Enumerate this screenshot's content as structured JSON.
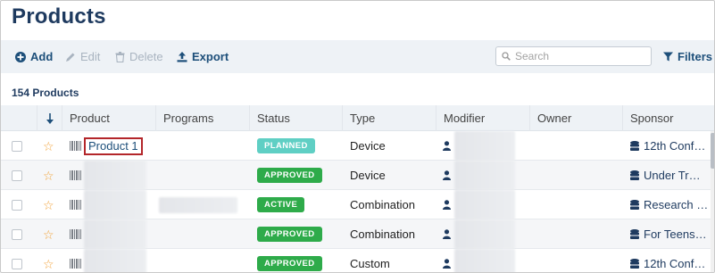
{
  "page": {
    "title": "Products"
  },
  "toolbar": {
    "add_label": "Add",
    "edit_label": "Edit",
    "delete_label": "Delete",
    "export_label": "Export",
    "filters_label": "Filters"
  },
  "search": {
    "placeholder": "Search",
    "value": ""
  },
  "summary": {
    "count_label": "154 Products"
  },
  "table": {
    "columns": [
      "Product",
      "Programs",
      "Status",
      "Type",
      "Modifier",
      "Owner",
      "Sponsor"
    ],
    "rows": [
      {
        "product": "Product 1",
        "status": "PLANNED",
        "status_kind": "planned",
        "type": "Device",
        "sponsor": "12th Conf…"
      },
      {
        "product": "",
        "status": "APPROVED",
        "status_kind": "approved",
        "type": "Device",
        "sponsor": "Under Tr…"
      },
      {
        "product": "",
        "status": "ACTIVE",
        "status_kind": "active",
        "type": "Combination",
        "sponsor": "Research …"
      },
      {
        "product": "",
        "status": "APPROVED",
        "status_kind": "approved",
        "type": "Combination",
        "sponsor": "For Teens…"
      },
      {
        "product": "",
        "status": "APPROVED",
        "status_kind": "approved",
        "type": "Custom",
        "sponsor": "12th Conf…"
      }
    ]
  },
  "colors": {
    "title": "#1e3a5f",
    "toolbar_bg": "#eef2f6",
    "planned": "#5fcfc4",
    "approved": "#2eab4a",
    "highlight_border": "#b3262a",
    "star": "#f2a33a"
  },
  "icons": [
    "plus-circle-icon",
    "pencil-icon",
    "trash-icon",
    "upload-icon",
    "search-icon",
    "filter-icon",
    "sort-down-arrow-icon",
    "star-icon",
    "barcode-icon",
    "person-icon",
    "database-icon"
  ]
}
